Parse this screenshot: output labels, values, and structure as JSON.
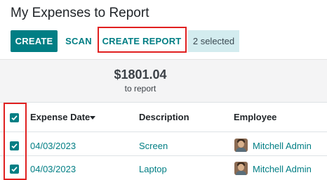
{
  "page": {
    "title": "My Expenses to Report"
  },
  "toolbar": {
    "create_label": "CREATE",
    "scan_label": "SCAN",
    "create_report_label": "CREATE REPORT",
    "selected_label": "2 selected"
  },
  "summary": {
    "amount": "$1801.04",
    "caption": "to report"
  },
  "table": {
    "columns": [
      "Expense Date",
      "Description",
      "Employee"
    ],
    "sorted_column": "Expense Date",
    "sort_direction": "descending",
    "header_checkbox_checked": true,
    "rows": [
      {
        "checked": true,
        "date": "04/03/2023",
        "description": "Screen",
        "employee": "Mitchell Admin"
      },
      {
        "checked": true,
        "date": "04/03/2023",
        "description": "Laptop",
        "employee": "Mitchell Admin"
      }
    ]
  },
  "colors": {
    "primary": "#017e84",
    "highlight_box": "#e02020",
    "selected_badge_bg": "#d3ecef",
    "summary_bg": "#f4f4f5"
  },
  "icons": {
    "sort": "caret-down-icon",
    "checkbox": "check-icon",
    "avatar": "user-avatar"
  }
}
